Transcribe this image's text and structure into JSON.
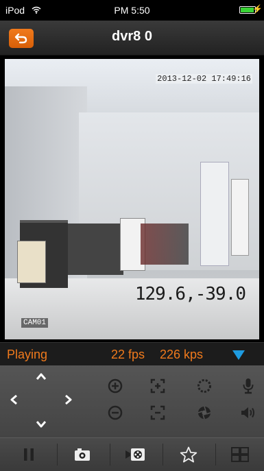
{
  "status_bar": {
    "carrier": "iPod",
    "time": "PM 5:50",
    "battery_level": 0.95
  },
  "nav": {
    "title": "dvr8 0",
    "back_icon": "back-arrow-icon"
  },
  "video": {
    "timestamp": "2013-12-02 17:49:16",
    "coordinates": "129.6,-39.0",
    "camera": "CAM01"
  },
  "info": {
    "status": "Playing",
    "fps": "22 fps",
    "bitrate": "226 kps"
  },
  "colors": {
    "accent": "#f07a1c",
    "dropdown": "#1e9be0",
    "battery": "#39d335"
  },
  "controls": {
    "ptz": [
      "up-arrow-icon",
      "down-arrow-icon",
      "left-arrow-icon",
      "right-arrow-icon"
    ],
    "zoom": [
      "zoom-in-icon",
      "zoom-out-icon"
    ],
    "focus": [
      "focus-near-icon",
      "focus-far-icon"
    ],
    "iris": [
      "iris-open-icon",
      "iris-close-icon"
    ],
    "audio": [
      "microphone-icon",
      "speaker-icon"
    ]
  },
  "toolbar": [
    "pause-icon",
    "snapshot-icon",
    "record-icon",
    "favorite-icon",
    "layout-icon"
  ]
}
